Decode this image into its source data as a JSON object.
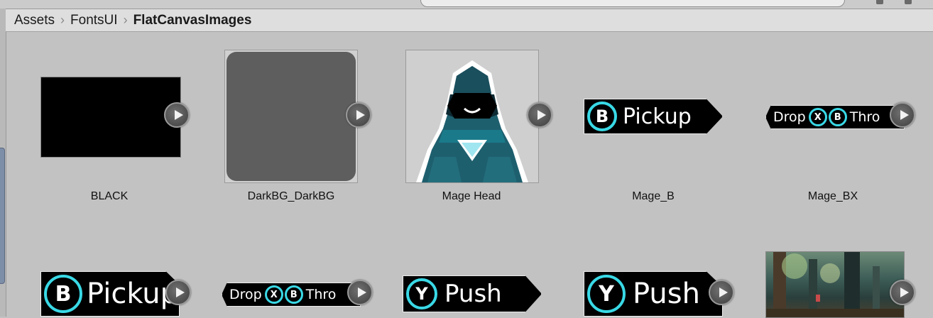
{
  "breadcrumb": {
    "items": [
      "Assets",
      "FontsUI",
      "FlatCanvasImages"
    ]
  },
  "assets": {
    "black": {
      "label": "BLACK"
    },
    "darkbg": {
      "label": "DarkBG_DarkBG"
    },
    "magehead": {
      "label": "Mage Head"
    },
    "mageb": {
      "label": "Mage_B",
      "button": "B",
      "text": "Pickup"
    },
    "magebx": {
      "label": "Mage_BX",
      "left": "Drop",
      "b1": "X",
      "b2": "B",
      "right": "Thro"
    },
    "row2_pickup": {
      "button": "B",
      "text": "Pickup"
    },
    "row2_dropthrow": {
      "left": "Drop",
      "b1": "X",
      "b2": "B",
      "right": "Thro"
    },
    "row2_push1": {
      "button": "Y",
      "text": "Push"
    },
    "row2_push2": {
      "button": "Y",
      "text": "Push"
    }
  },
  "colors": {
    "accent": "#39d9e6",
    "background": "#c2c2c2",
    "breadcrumb_bg": "#dedede"
  }
}
